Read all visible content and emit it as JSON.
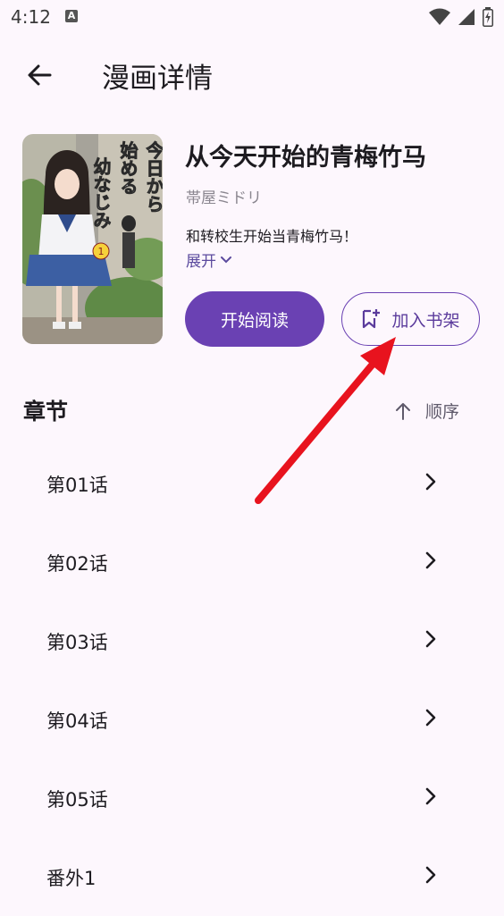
{
  "status": {
    "time": "4:12",
    "notif_letter": "A"
  },
  "appbar": {
    "title": "漫画详情"
  },
  "comic": {
    "title": "从今天开始的青梅竹马",
    "author": "帯屋ミドリ",
    "description": "和转校生开始当青梅竹马！",
    "expand_label": "展开",
    "cover_text": [
      "今日から",
      "始める",
      "幼なじみ"
    ],
    "cover_volume": "1"
  },
  "actions": {
    "read_label": "开始阅读",
    "shelf_label": "加入书架"
  },
  "chapters": {
    "heading": "章节",
    "sort_label": "顺序",
    "items": [
      {
        "label": "第01话"
      },
      {
        "label": "第02话"
      },
      {
        "label": "第03话"
      },
      {
        "label": "第04话"
      },
      {
        "label": "第05话"
      },
      {
        "label": "番外1"
      }
    ]
  },
  "colors": {
    "primary": "#6a41b3",
    "background": "#fdf7fd",
    "annotation_arrow": "#e8131e"
  }
}
